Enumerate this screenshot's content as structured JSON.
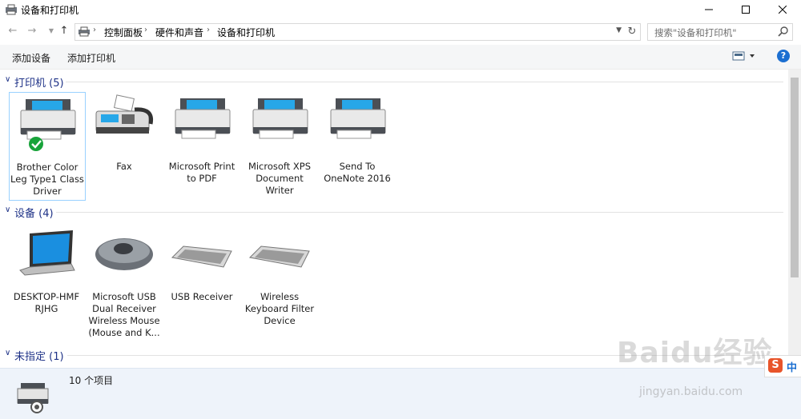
{
  "window": {
    "title": "设备和打印机"
  },
  "address": {
    "crumbs": [
      "控制面板",
      "硬件和声音",
      "设备和打印机"
    ],
    "search_placeholder": "搜索\"设备和打印机\""
  },
  "toolbar": {
    "add_device": "添加设备",
    "add_printer": "添加打印机",
    "help": "?"
  },
  "groups": {
    "printers": {
      "title": "打印机 (5)",
      "items": [
        {
          "label": "Brother Color Leg Type1 Class Driver",
          "icon": "printer-default-icon"
        },
        {
          "label": "Fax",
          "icon": "fax-icon"
        },
        {
          "label": "Microsoft Print to PDF",
          "icon": "printer-icon"
        },
        {
          "label": "Microsoft XPS Document Writer",
          "icon": "printer-icon"
        },
        {
          "label": "Send To OneNote 2016",
          "icon": "printer-icon"
        }
      ]
    },
    "devices": {
      "title": "设备 (4)",
      "items": [
        {
          "label": "DESKTOP-HMF RJHG",
          "icon": "laptop-icon"
        },
        {
          "label": "Microsoft USB Dual Receiver Wireless Mouse (Mouse and K...",
          "icon": "mouse-icon"
        },
        {
          "label": "USB Receiver",
          "icon": "keyboard-icon"
        },
        {
          "label": "Wireless Keyboard Filter Device",
          "icon": "keyboard-icon"
        }
      ]
    },
    "unspecified": {
      "title": "未指定 (1)"
    }
  },
  "status": {
    "count": "10 个项目"
  },
  "watermark": {
    "brand": "Baidu经验",
    "url": "jingyan.baidu.com",
    "ime": "中"
  },
  "colors": {
    "group_title": "#1e3287",
    "selection_border": "#99d1ff",
    "status_bg": "#eef3fa",
    "help": "#1c6fd1"
  }
}
